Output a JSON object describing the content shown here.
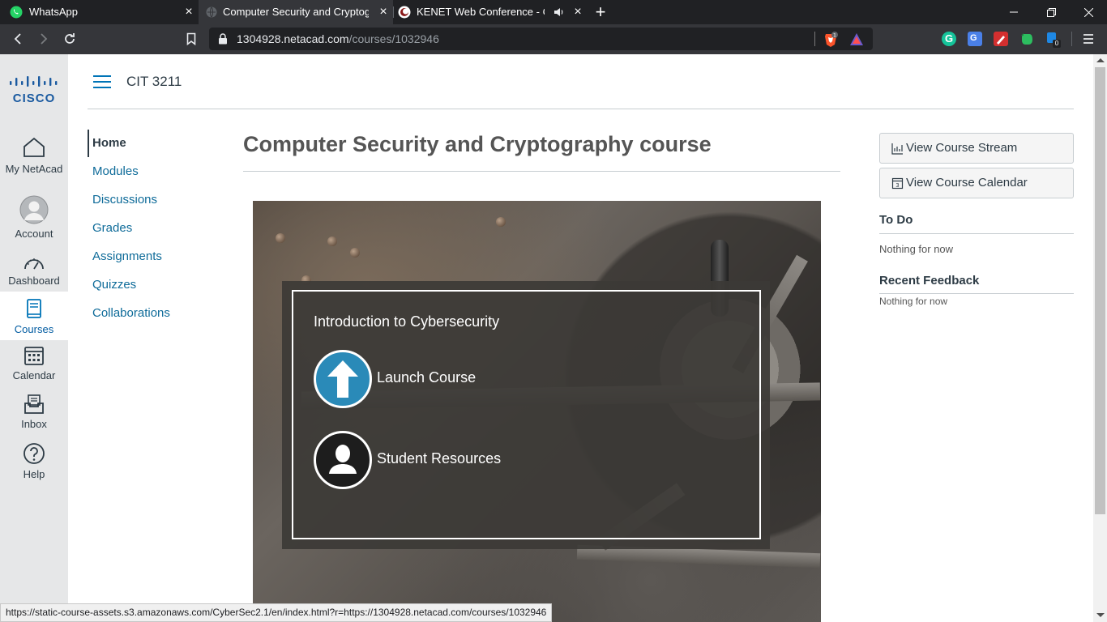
{
  "browser": {
    "tabs": [
      {
        "title": "WhatsApp",
        "favicon": "whatsapp-icon"
      },
      {
        "title": "Computer Security and Cryptograp",
        "favicon": "globe-icon"
      },
      {
        "title": "KENET Web Conference - CCS",
        "favicon": "kenet-icon"
      }
    ],
    "url_host": "1304928.netacad.com",
    "url_path": "/courses/1032946",
    "brave_count": "1",
    "ext_badge": "0",
    "status_url": "https://static-course-assets.s3.amazonaws.com/CyberSec2.1/en/index.html?r=https://1304928.netacad.com/courses/1032946"
  },
  "global_nav": {
    "logo_text": "CISCO",
    "items": [
      {
        "label": "My NetAcad",
        "icon": "home-icon"
      },
      {
        "label": "Account",
        "icon": "avatar-icon"
      },
      {
        "label": "Dashboard",
        "icon": "dashboard-icon"
      },
      {
        "label": "Courses",
        "icon": "courses-icon"
      },
      {
        "label": "Calendar",
        "icon": "calendar-icon"
      },
      {
        "label": "Inbox",
        "icon": "inbox-icon"
      },
      {
        "label": "Help",
        "icon": "help-icon"
      }
    ]
  },
  "header": {
    "course_code": "CIT 3211"
  },
  "course_nav": {
    "items": [
      "Home",
      "Modules",
      "Discussions",
      "Grades",
      "Assignments",
      "Quizzes",
      "Collaborations"
    ]
  },
  "main": {
    "title": "Computer Security and Cryptography course",
    "hero": {
      "heading": "Introduction to Cybersecurity",
      "launch_label": "Launch Course",
      "resources_label": "Student Resources"
    }
  },
  "sidebar": {
    "stream_button": "View Course Stream",
    "calendar_button": "View Course Calendar",
    "calendar_icon_digit": "3",
    "todo_heading": "To Do",
    "todo_text": "Nothing for now",
    "feedback_heading": "Recent Feedback",
    "feedback_text": "Nothing for now"
  },
  "colors": {
    "link": "#0e6b99",
    "accent": "#0074b7",
    "text": "#2d3b45",
    "chrome_dark": "#202124",
    "launch_circle": "#2a8ab8"
  }
}
